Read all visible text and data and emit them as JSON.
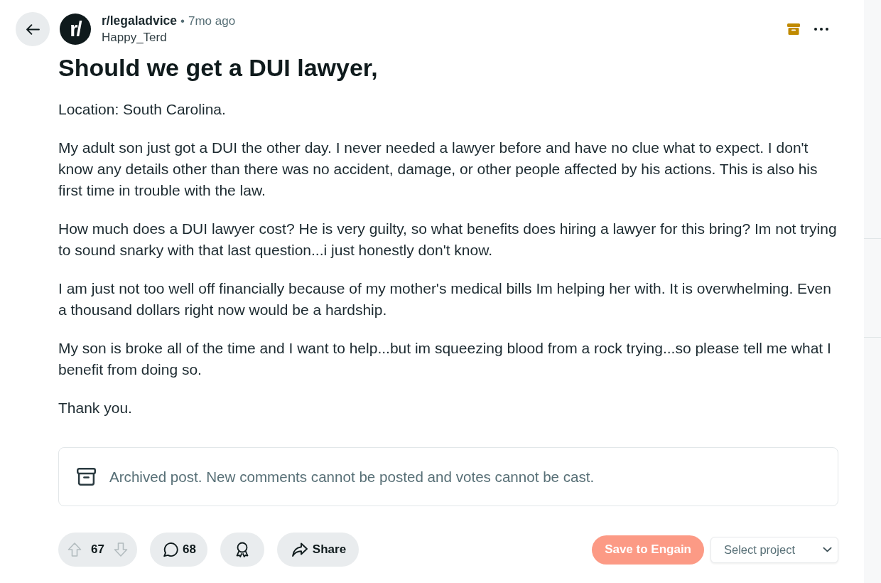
{
  "post": {
    "subreddit": {
      "icon_text": "r/",
      "name": "r/legaladvice"
    },
    "separator": "•",
    "age": "7mo ago",
    "author": "Happy_Terd",
    "archived": true,
    "title": "Should we get a DUI lawyer,",
    "body": [
      "Location: South Carolina.",
      "My adult son just got a DUI the other day. I never needed a lawyer before and have no clue what to expect. I don't know any details other than there was no accident, damage, or other people affected by his actions. This is also his first time in trouble with the law.",
      "How much does a DUI lawyer cost? He is very guilty, so what benefits does hiring a lawyer for this bring? Im not trying to sound snarky with that last question...i just honestly don't know.",
      "I am just not too well off financially because of my mother's medical bills Im helping her with. It is overwhelming. Even a thousand dollars right now would be a hardship.",
      "My son is broke all of the time and I want to help...but im squeezing blood from a rock trying...so please tell me what I benefit from doing so.",
      "Thank you."
    ],
    "archived_notice": "Archived post. New comments cannot be posted and votes cannot be cast.",
    "votes": {
      "count": "67",
      "disabled": true
    },
    "comments": {
      "count": "68"
    },
    "share": {
      "label": "Share"
    }
  },
  "engain": {
    "save_button": {
      "label": "Save to Engain"
    },
    "project_select": {
      "placeholder": "Select project"
    }
  }
}
